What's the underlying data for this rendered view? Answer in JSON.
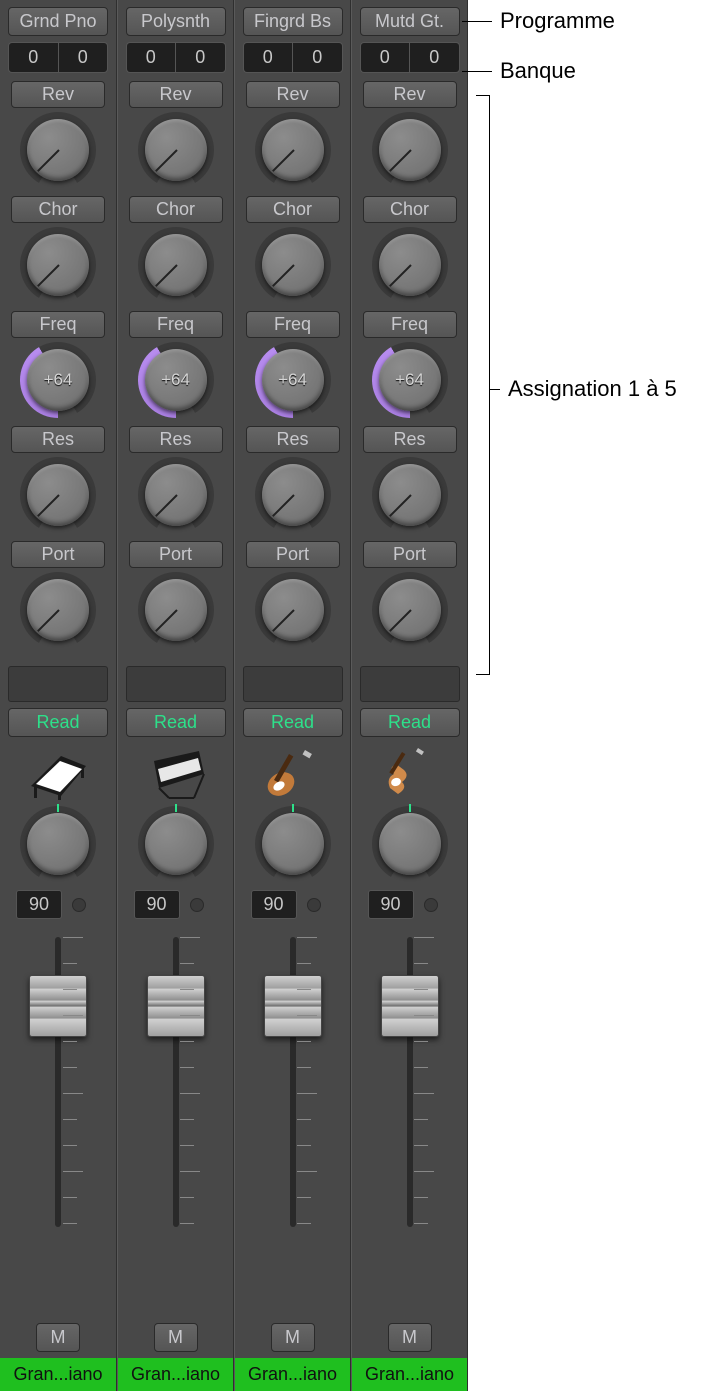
{
  "callouts": {
    "programme": "Programme",
    "banque": "Banque",
    "assignation": "Assignation 1 à 5"
  },
  "assignLabels": [
    "Rev",
    "Chor",
    "Freq",
    "Res",
    "Port"
  ],
  "freqValue": "+64",
  "channels": [
    {
      "program": "Grnd Pno",
      "bankA": "0",
      "bankB": "0",
      "read": "Read",
      "vol": "90",
      "mute": "M",
      "name": "Gran...iano",
      "instrument": "piano"
    },
    {
      "program": "Polysnth",
      "bankA": "0",
      "bankB": "0",
      "read": "Read",
      "vol": "90",
      "mute": "M",
      "name": "Gran...iano",
      "instrument": "synth"
    },
    {
      "program": "Fingrd Bs",
      "bankA": "0",
      "bankB": "0",
      "read": "Read",
      "vol": "90",
      "mute": "M",
      "name": "Gran...iano",
      "instrument": "bass"
    },
    {
      "program": "Mutd Gt.",
      "bankA": "0",
      "bankB": "0",
      "read": "Read",
      "vol": "90",
      "mute": "M",
      "name": "Gran...iano",
      "instrument": "guitar"
    }
  ]
}
